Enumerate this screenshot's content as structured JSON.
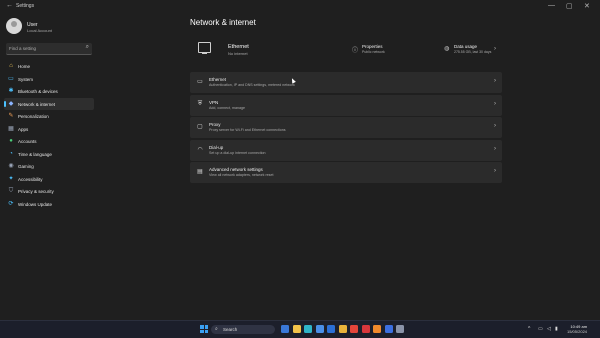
{
  "window": {
    "title": "Settings",
    "back_glyph": "←",
    "minimize_glyph": "—",
    "maximize_glyph": "▢",
    "close_glyph": "✕"
  },
  "user": {
    "name": "User",
    "account": "Local Account"
  },
  "search": {
    "placeholder": "Find a setting",
    "icon": "⌕"
  },
  "sidebar": {
    "items": [
      {
        "label": "Home",
        "icon": "⌂",
        "icon_name": "home-icon",
        "color": "#f0c85a"
      },
      {
        "label": "System",
        "icon": "▭",
        "icon_name": "system-icon",
        "color": "#4cc2ff"
      },
      {
        "label": "Bluetooth & devices",
        "icon": "✱",
        "icon_name": "bluetooth-icon",
        "color": "#4cc2ff"
      },
      {
        "label": "Network & internet",
        "icon": "◆",
        "icon_name": "network-icon",
        "color": "#8cb4ff",
        "active": true
      },
      {
        "label": "Personalization",
        "icon": "✎",
        "icon_name": "personalization-icon",
        "color": "#f4a259"
      },
      {
        "label": "Apps",
        "icon": "▦",
        "icon_name": "apps-icon",
        "color": "#9aa5b8"
      },
      {
        "label": "Accounts",
        "icon": "●",
        "icon_name": "accounts-icon",
        "color": "#4ccf7a"
      },
      {
        "label": "Time & language",
        "icon": "◔",
        "icon_name": "time-language-icon",
        "color": "#4cc2ff"
      },
      {
        "label": "Gaming",
        "icon": "◉",
        "icon_name": "gaming-icon",
        "color": "#9aa5b8"
      },
      {
        "label": "Accessibility",
        "icon": "✦",
        "icon_name": "accessibility-icon",
        "color": "#4cc2ff"
      },
      {
        "label": "Privacy & security",
        "icon": "⛉",
        "icon_name": "privacy-icon",
        "color": "#9aa5b8"
      },
      {
        "label": "Windows Update",
        "icon": "⟳",
        "icon_name": "windows-update-icon",
        "color": "#4cc2ff"
      }
    ]
  },
  "page": {
    "title": "Network & internet"
  },
  "summary": {
    "connection": {
      "title": "Ethernet",
      "status": "No internet"
    },
    "properties": {
      "title": "Properties",
      "sub": "Public network",
      "icon": "ⓘ"
    },
    "data_usage": {
      "title": "Data usage",
      "sub": "275.55 GB, last 30 days",
      "icon": "◍",
      "chevron": "›"
    }
  },
  "cards": [
    {
      "title": "Ethernet",
      "sub": "Authentication, IP and DNS settings, metered network",
      "icon": "▭",
      "icon_name": "ethernet-icon",
      "chevron": "›"
    },
    {
      "title": "VPN",
      "sub": "Add, connect, manage",
      "icon": "⛨",
      "icon_name": "vpn-icon",
      "chevron": "›"
    },
    {
      "title": "Proxy",
      "sub": "Proxy server for Wi-Fi and Ethernet connections",
      "icon": "▢",
      "icon_name": "proxy-icon",
      "chevron": "›"
    },
    {
      "title": "Dial-up",
      "sub": "Set up a dial-up internet connection",
      "icon": "◠",
      "icon_name": "dial-up-icon",
      "chevron": "›"
    },
    {
      "title": "Advanced network settings",
      "sub": "View all network adapters, network reset",
      "icon": "▤",
      "icon_name": "advanced-network-icon",
      "chevron": "›"
    }
  ],
  "taskbar": {
    "search_placeholder": "Search",
    "search_icon": "⌕",
    "time": "10:49 am",
    "date": "15/05/2024",
    "tray": {
      "chevron": "^",
      "network": "▭",
      "volume": "◁",
      "battery": "▮"
    },
    "apps": [
      {
        "name": "widgets-app-icon",
        "color": "#3a78d8"
      },
      {
        "name": "file-explorer-icon",
        "color": "#f1c24a"
      },
      {
        "name": "edge-browser-icon",
        "color": "#2fb5c9"
      },
      {
        "name": "store-icon",
        "color": "#4a8fe8"
      },
      {
        "name": "word-icon",
        "color": "#2b6fd6"
      },
      {
        "name": "folder-icon",
        "color": "#e8b23a"
      },
      {
        "name": "chrome-icon",
        "color": "#e4453a"
      },
      {
        "name": "app-red-icon",
        "color": "#d8373c"
      },
      {
        "name": "app-orange-icon",
        "color": "#f08a2c"
      },
      {
        "name": "app-blue-icon",
        "color": "#3c6fe0"
      },
      {
        "name": "settings-app-icon",
        "color": "#8a93a8"
      }
    ]
  }
}
